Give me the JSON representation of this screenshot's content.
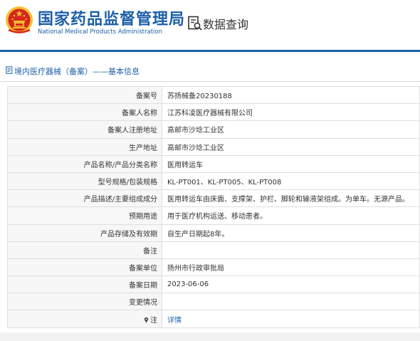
{
  "header": {
    "title_cn": "国家药品监督管理局",
    "title_en": "National Medical Products Administration",
    "query_label": "数据查询"
  },
  "breadcrumb": "境内医疗器械（备案）——基本信息",
  "rows": [
    {
      "label": "备案号",
      "value": "苏扬械备20230188"
    },
    {
      "label": "备案人名称",
      "value": "江苏科凌医疗器械有限公司"
    },
    {
      "label": "备案人注册地址",
      "value": "高邮市沙埝工业区"
    },
    {
      "label": "生产地址",
      "value": "高邮市沙埝工业区"
    },
    {
      "label": "产品名称/产品分类名称",
      "value": "医用转运车"
    },
    {
      "label": "型号规格/包装规格",
      "value": "KL-PT001、KL-PT005、KL-PT008"
    },
    {
      "label": "产品描述/主要组成成分",
      "value": "医用转运车由床面、支撑架、护栏、脚轮和输液架组成。为单车。无源产品。"
    },
    {
      "label": "预期用途",
      "value": "用于医疗机构运送、移动患者。"
    },
    {
      "label": "产品存储及有效期",
      "value": "自生产日期起8年。"
    },
    {
      "label": "备注",
      "value": ""
    },
    {
      "label": "备案单位",
      "value": "扬州市行政审批局"
    },
    {
      "label": "备案日期",
      "value": "2023-06-06"
    },
    {
      "label": "变更情况",
      "value": ""
    },
    {
      "label": "注",
      "value": "详情"
    }
  ],
  "colors": {
    "brand_blue": "#1d5fa8",
    "emblem_red": "#d7261c",
    "emblem_gold": "#f2c12e"
  },
  "icons": {
    "emblem": "national-emblem-icon",
    "query": "search-document-icon",
    "breadcrumb": "document-icon",
    "note": "pin-icon"
  }
}
